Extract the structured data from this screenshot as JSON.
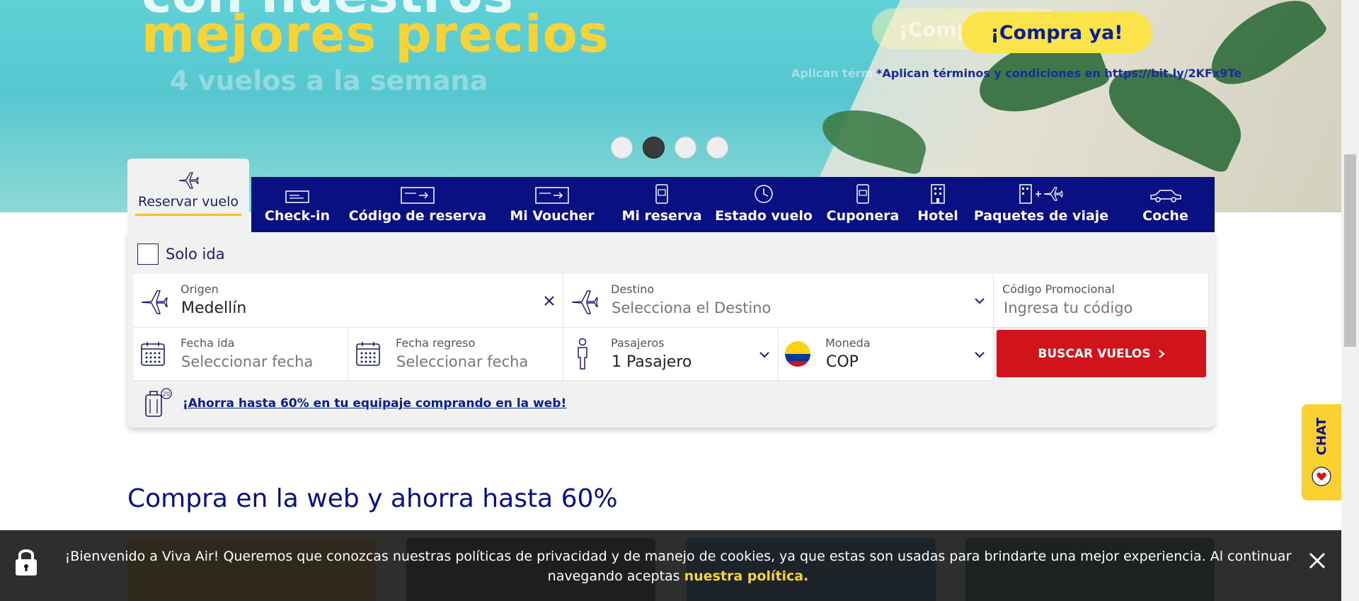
{
  "hero": {
    "ghost_top": "con nuestros",
    "headline": "mejores precios",
    "ghost_sub": "4 vuelos a la semana",
    "cta_ghost": "¡Compra ya!",
    "cta": "¡Compra ya!",
    "terms_ghost": "Aplican térm",
    "terms": "*Aplican términos y condiciones en https://bit.ly/2KFx9Te",
    "carousel_active_index": 2,
    "carousel_count": 4
  },
  "tabs": {
    "active": "Reservar vuelo",
    "items": [
      {
        "label": "Check-in",
        "icon": "ticket-icon"
      },
      {
        "label": "Código de reserva",
        "icon": "booking-code-icon"
      },
      {
        "label": "Mi Voucher",
        "icon": "voucher-icon"
      },
      {
        "label": "Mi reserva",
        "icon": "phone-ticket-icon"
      },
      {
        "label": "Estado vuelo",
        "icon": "clock-icon"
      },
      {
        "label": "Cuponera",
        "icon": "coupon-phone-icon"
      },
      {
        "label": "Hotel",
        "icon": "hotel-icon"
      },
      {
        "label": "Paquetes de viaje",
        "icon": "package-icon"
      },
      {
        "label": "Coche",
        "icon": "car-icon"
      }
    ]
  },
  "form": {
    "solo_ida": "Solo ida",
    "origen_label": "Origen",
    "origen_value": "Medellín",
    "destino_label": "Destino",
    "destino_placeholder": "Selecciona el Destino",
    "promo_label": "Código Promocional",
    "promo_placeholder": "Ingresa tu código",
    "fecha_ida_label": "Fecha ida",
    "fecha_ida_placeholder": "Seleccionar fecha",
    "fecha_regreso_label": "Fecha regreso",
    "fecha_regreso_placeholder": "Seleccionar fecha",
    "pasajeros_label": "Pasajeros",
    "pasajeros_value": "1 Pasajero",
    "moneda_label": "Moneda",
    "moneda_value": "COP",
    "search_button": "BUSCAR VUELOS",
    "baggage_promo": "¡Ahorra hasta 60% en tu equipaje comprando en la web!"
  },
  "section": {
    "title": "Compra en la web y ahorra hasta 60%"
  },
  "chat": {
    "label": "CHAT"
  },
  "cookie": {
    "text": "¡Bienvenido a Viva Air! Queremos que conozcas nuestras políticas de privacidad y de manejo de cookies, ya que estas son usadas para brindarte una mejor experiencia. Al continuar navegando aceptas",
    "link": "nuestra política."
  },
  "colors": {
    "brand_blue": "#091082",
    "accent_yellow": "#fbe34a",
    "search_red": "#d1141b"
  }
}
